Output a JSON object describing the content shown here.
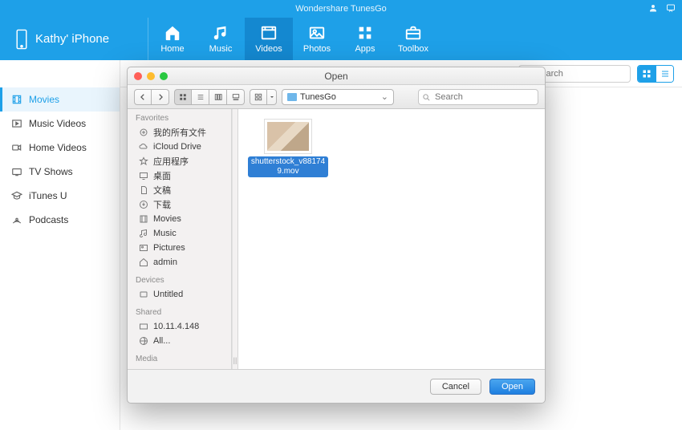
{
  "app": {
    "title": "Wondershare TunesGo"
  },
  "device": {
    "name": "Kathy' iPhone"
  },
  "nav": {
    "home": "Home",
    "music": "Music",
    "videos": "Videos",
    "photos": "Photos",
    "apps": "Apps",
    "toolbox": "Toolbox"
  },
  "toolbar": {
    "search_placeholder": "Search"
  },
  "sidebar": {
    "movies": "Movies",
    "music_videos": "Music Videos",
    "home_videos": "Home Videos",
    "tv_shows": "TV Shows",
    "itunes_u": "iTunes U",
    "podcasts": "Podcasts"
  },
  "dialog": {
    "title": "Open",
    "path_label": "TunesGo",
    "search_placeholder": "Search",
    "sections": {
      "favorites": "Favorites",
      "devices": "Devices",
      "shared": "Shared",
      "media": "Media"
    },
    "favorites": {
      "all_my_files": "我的所有文件",
      "icloud": "iCloud Drive",
      "applications": "应用程序",
      "desktop": "桌面",
      "documents": "文稿",
      "downloads": "下载",
      "movies": "Movies",
      "music": "Music",
      "pictures": "Pictures",
      "admin": "admin"
    },
    "devices": {
      "untitled": "Untitled"
    },
    "shared": {
      "ip": "10.11.4.148",
      "all": "All..."
    },
    "file_name": "shutterstock_v881749.mov",
    "cancel": "Cancel",
    "open": "Open"
  }
}
